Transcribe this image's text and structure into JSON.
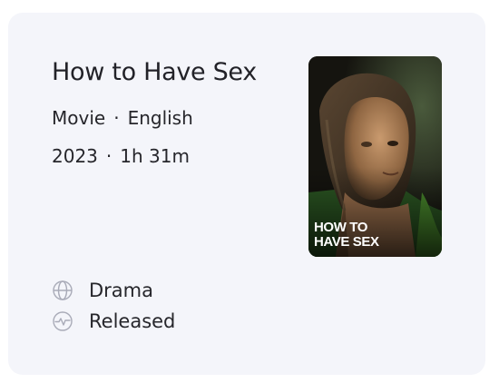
{
  "title": "How to Have Sex",
  "meta": {
    "type": "Movie",
    "language": "English",
    "year": "2023",
    "runtime": "1h 31m",
    "separator": "·"
  },
  "poster": {
    "overlay_text": "HOW TO\nHAVE SEX"
  },
  "details": {
    "genre": {
      "icon": "globe-icon",
      "label": "Drama"
    },
    "status": {
      "icon": "pulse-icon",
      "label": "Released"
    }
  },
  "colors": {
    "card_background": "#f4f5fa",
    "text": "#26262b",
    "icon": "#a9abb8"
  }
}
